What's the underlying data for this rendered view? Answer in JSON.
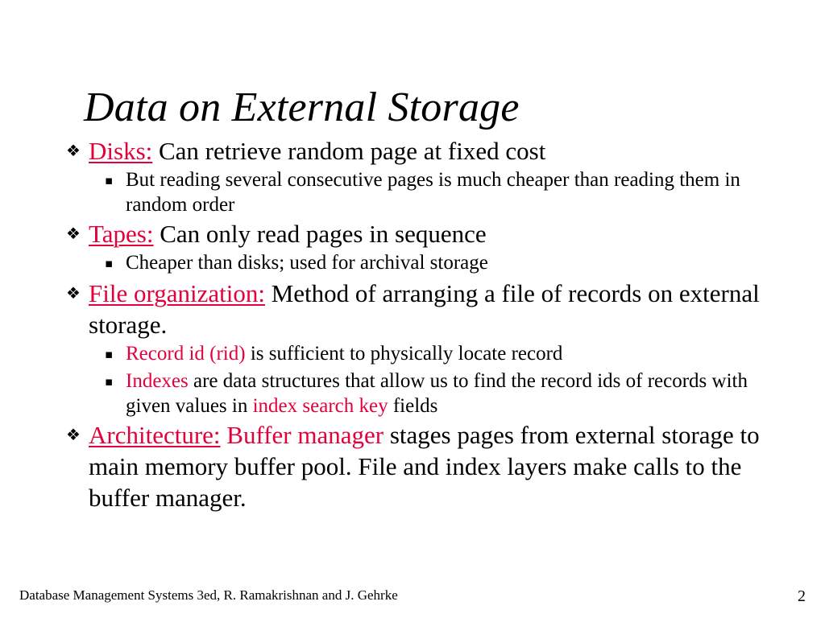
{
  "slide": {
    "title": "Data on External Storage",
    "bullets": [
      {
        "level": 1,
        "marker": "diamond-bullet",
        "marker_glyph": "❖",
        "segments": [
          {
            "text": "Disks:",
            "style": "red-underline"
          },
          {
            "text": " Can retrieve random page at fixed cost",
            "style": "plain"
          }
        ]
      },
      {
        "level": 2,
        "marker": "square-bullet",
        "marker_glyph": "▪",
        "segments": [
          {
            "text": "But reading several consecutive pages is much cheaper than reading them in random order",
            "style": "plain"
          }
        ]
      },
      {
        "level": 1,
        "marker": "diamond-bullet",
        "marker_glyph": "❖",
        "segments": [
          {
            "text": "Tapes:",
            "style": "red-underline"
          },
          {
            "text": " Can only read pages in sequence",
            "style": "plain"
          }
        ]
      },
      {
        "level": 2,
        "marker": "square-bullet",
        "marker_glyph": "▪",
        "segments": [
          {
            "text": "Cheaper than disks; used for archival storage",
            "style": "plain"
          }
        ]
      },
      {
        "level": 1,
        "marker": "diamond-bullet",
        "marker_glyph": "❖",
        "segments": [
          {
            "text": "File organization:",
            "style": "red-underline"
          },
          {
            "text": " Method of arranging a file of records on external storage.",
            "style": "plain"
          }
        ]
      },
      {
        "level": 2,
        "marker": "square-bullet",
        "marker_glyph": "▪",
        "segments": [
          {
            "text": "Record id (rid)",
            "style": "red"
          },
          {
            "text": " is sufficient to physically locate record",
            "style": "plain"
          }
        ]
      },
      {
        "level": 2,
        "marker": "square-bullet",
        "marker_glyph": "▪",
        "segments": [
          {
            "text": "Indexes",
            "style": "red"
          },
          {
            "text": " are data structures that allow us to find the record ids of records with given values in ",
            "style": "plain"
          },
          {
            "text": "index search key",
            "style": "red"
          },
          {
            "text": " fields",
            "style": "plain"
          }
        ]
      },
      {
        "level": 1,
        "marker": "diamond-bullet",
        "marker_glyph": "❖",
        "segments": [
          {
            "text": "Architecture:",
            "style": "red-underline"
          },
          {
            "text": " ",
            "style": "plain"
          },
          {
            "text": "Buffer manager",
            "style": "red"
          },
          {
            "text": " stages pages from external storage to main memory buffer pool. File and index layers make calls to the buffer manager.",
            "style": "plain"
          }
        ]
      }
    ]
  },
  "footer": {
    "credit": "Database Management Systems 3ed, R. Ramakrishnan and J. Gehrke",
    "page_number": "2"
  },
  "colors": {
    "accent_red": "#E4003A",
    "text_black": "#000000",
    "background": "#FFFFFF"
  }
}
